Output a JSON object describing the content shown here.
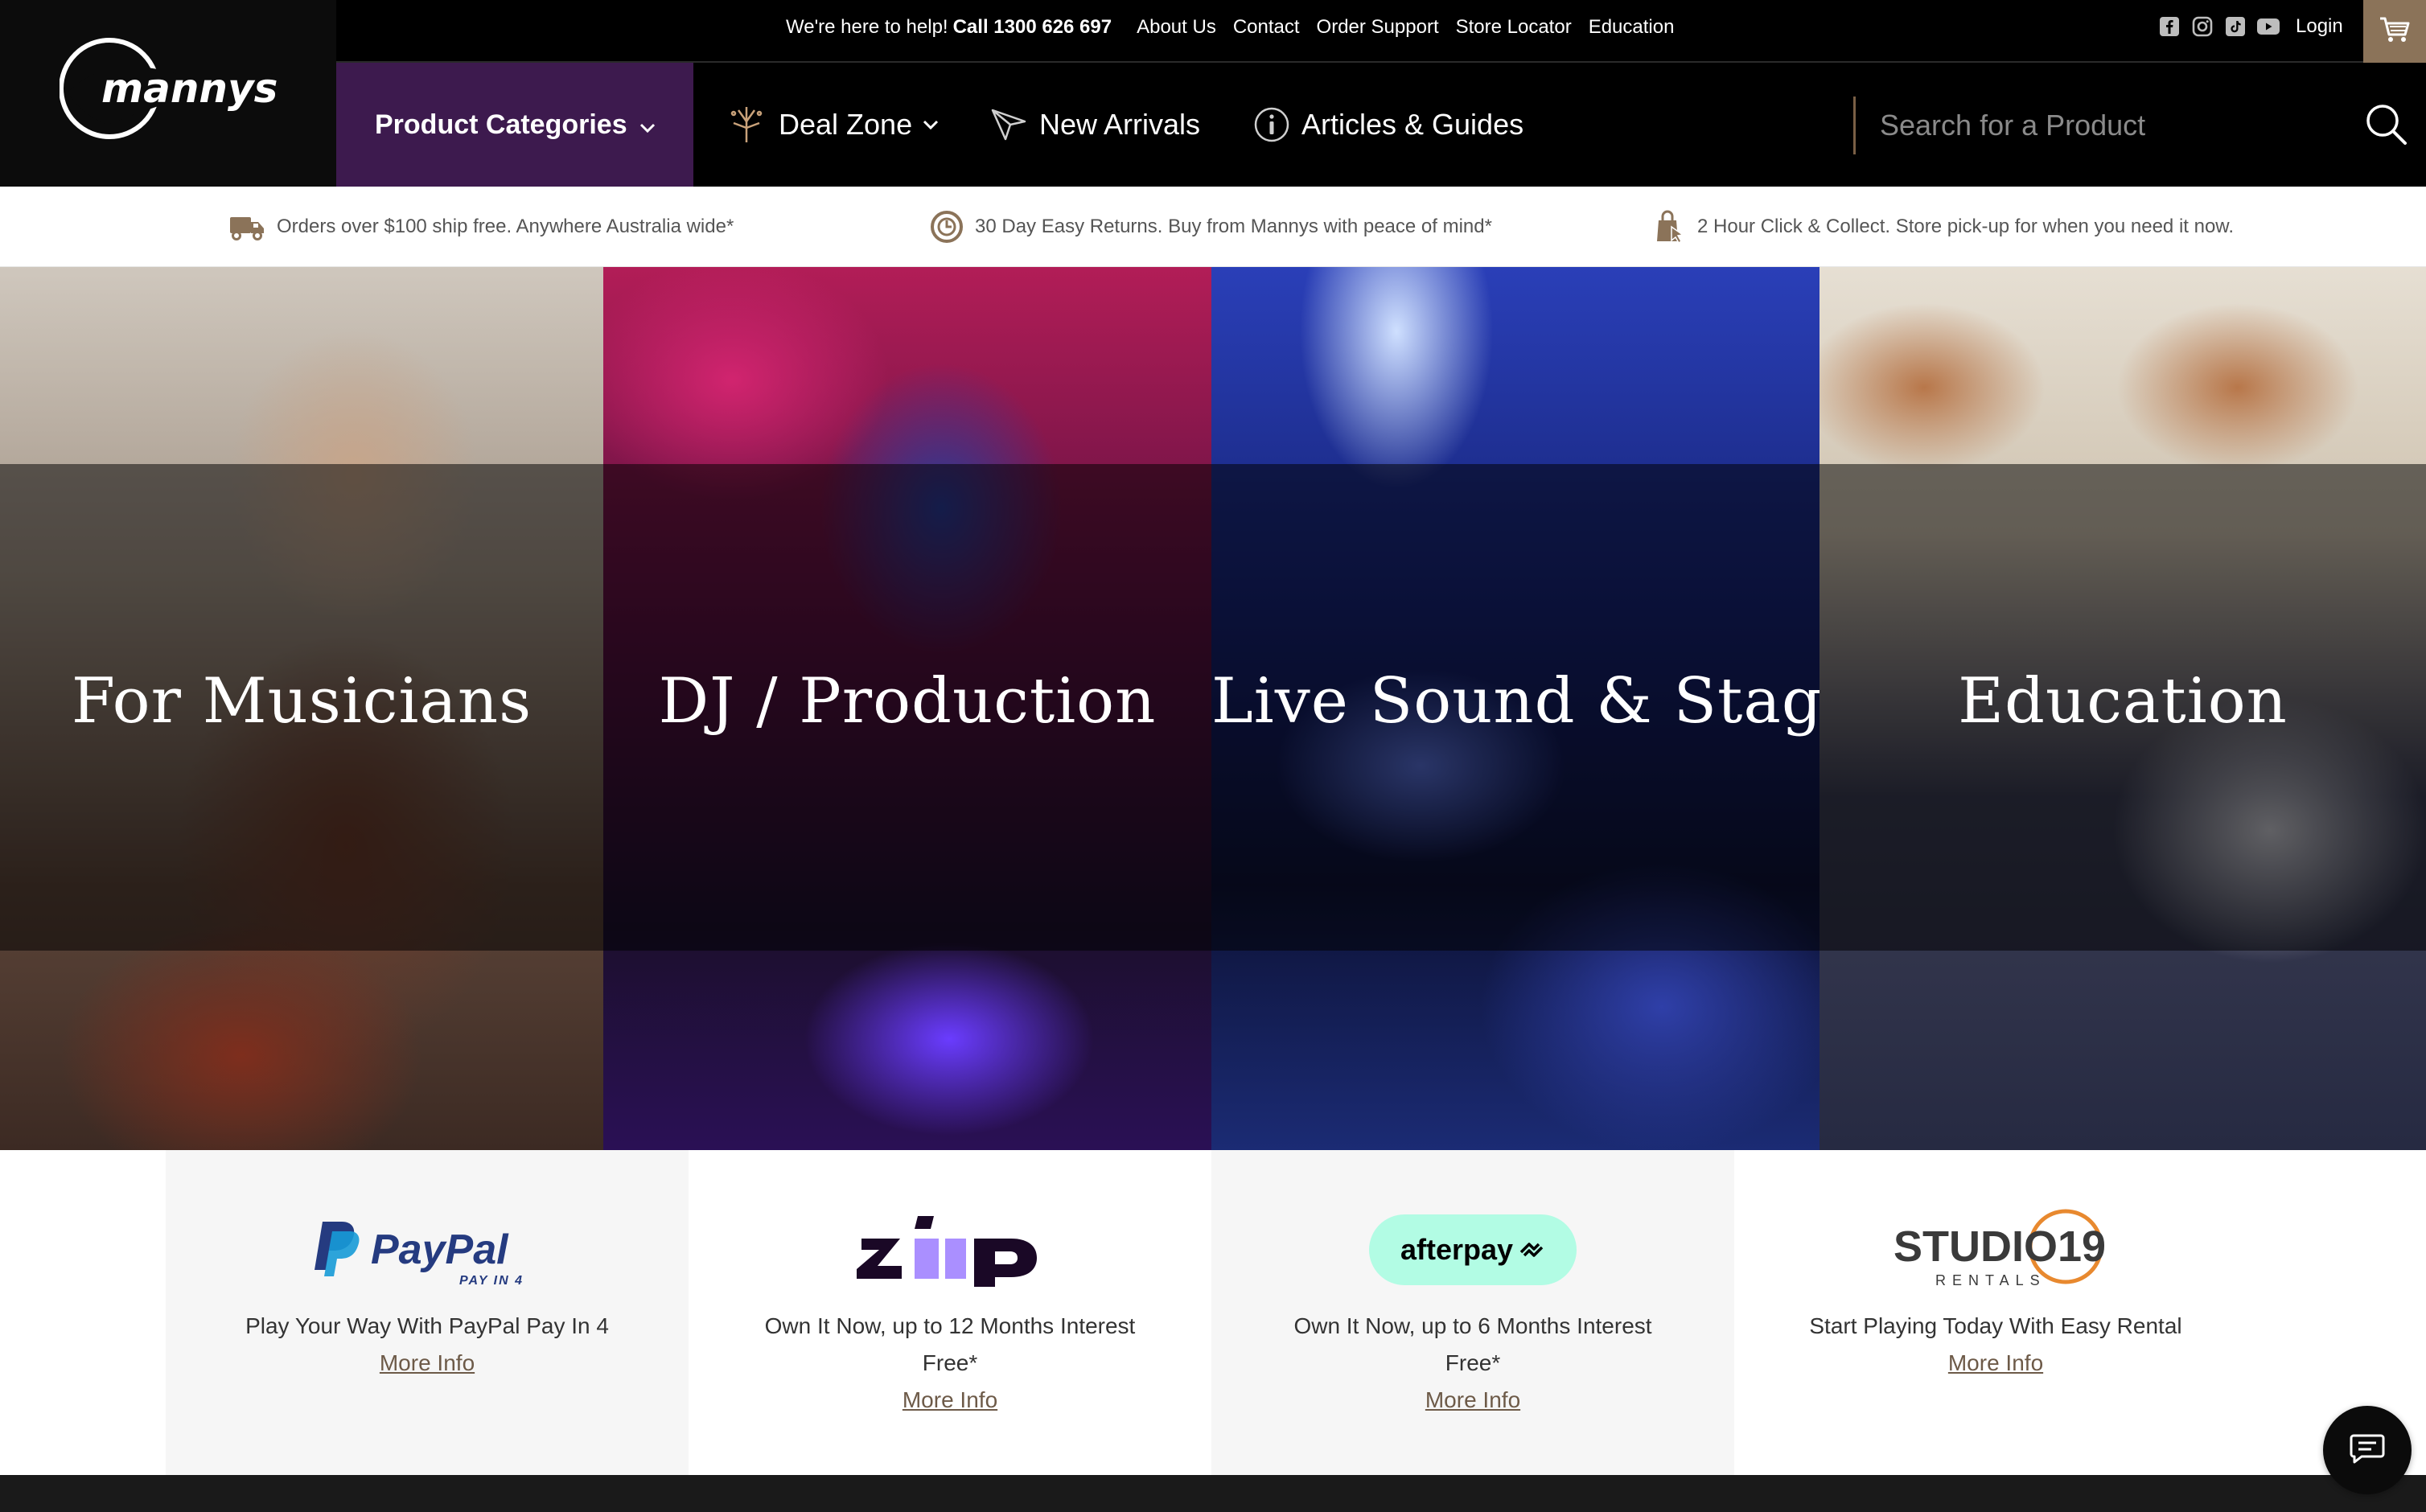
{
  "topbar": {
    "help_text": "We're here to help!",
    "phone": "Call 1300 626 697",
    "links": [
      "About Us",
      "Contact",
      "Order Support",
      "Store Locator",
      "Education"
    ],
    "social_icons": [
      "facebook-icon",
      "instagram-icon",
      "tiktok-icon",
      "youtube-icon"
    ],
    "login": "Login"
  },
  "brand": {
    "logo_text": "mannys"
  },
  "nav": {
    "categories": "Product Categories",
    "deal_zone": "Deal Zone",
    "new_arrivals": "New Arrivals",
    "articles": "Articles & Guides",
    "search_placeholder": "Search for a Product"
  },
  "info_strip": [
    {
      "icon": "truck-icon",
      "text": "Orders over $100 ship free. Anywhere Australia wide*"
    },
    {
      "icon": "returns-badge-icon",
      "text": "30 Day Easy Returns. Buy from Mannys with peace of mind*"
    },
    {
      "icon": "click-collect-icon",
      "text": "2 Hour Click & Collect. Store pick-up for when you need it now."
    }
  ],
  "tiles": [
    {
      "title": "For Musicians"
    },
    {
      "title": "DJ / Production"
    },
    {
      "title": "Live Sound & Stage"
    },
    {
      "title": "Education"
    }
  ],
  "payments": [
    {
      "logo": "PayPal",
      "logo_sub": "PAY IN 4",
      "desc": "Play Your Way With PayPal Pay In 4",
      "link": "More Info"
    },
    {
      "logo": "zip",
      "desc": "Own It Now, up to 12 Months Interest Free*",
      "link": "More Info"
    },
    {
      "logo": "afterpay",
      "desc": "Own It Now, up to 6 Months Interest Free*",
      "link": "More Info"
    },
    {
      "logo": "STUDIO19",
      "logo_sub": "RENTALS",
      "desc": "Start Playing Today With Easy Rental",
      "link": "More Info"
    }
  ],
  "colors": {
    "accent_purple": "#3d1a4e",
    "accent_brown": "#8b7359",
    "afterpay_mint": "#b2fce4",
    "zip_purple": "#aa8fff",
    "paypal_blue": "#253b80",
    "paypal_light": "#179bd7",
    "studio19_orange": "#e8892f"
  }
}
